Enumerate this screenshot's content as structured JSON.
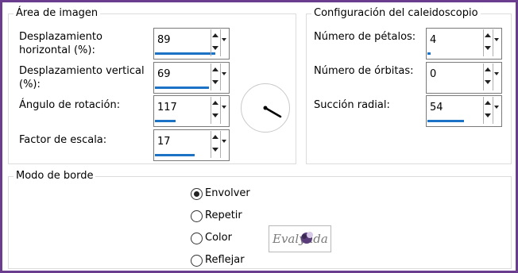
{
  "image_area": {
    "title": "Área de imagen",
    "fields": [
      {
        "label_line1": "Desplazamiento",
        "label_line2": "horizontal (%):",
        "value": "89",
        "fill": 0.95
      },
      {
        "label_line1": "Desplazamiento vertical",
        "label_line2": "(%):",
        "value": "69",
        "fill": 0.85
      },
      {
        "label_line1": "Ángulo de rotación:",
        "label_line2": "",
        "value": "117",
        "fill": 0.33
      },
      {
        "label_line1": "Factor de escala:",
        "label_line2": "",
        "value": "17",
        "fill": 0.62
      }
    ]
  },
  "kaleidoscope": {
    "title": "Configuración del caleidoscopio",
    "fields": [
      {
        "label": "Número de pétalos:",
        "value": "4",
        "fill": 0.05
      },
      {
        "label": "Número de órbitas:",
        "value": "0",
        "fill": 0.0
      },
      {
        "label": "Succión radial:",
        "value": "54",
        "fill": 0.58
      }
    ]
  },
  "border_mode": {
    "title": "Modo de borde",
    "options": [
      {
        "label": "Envolver",
        "checked": true
      },
      {
        "label": "Repetir",
        "checked": false
      },
      {
        "label": "Color",
        "checked": false
      },
      {
        "label": "Reflejar",
        "checked": false
      }
    ],
    "color_swatch_text": "Evalynda"
  },
  "colors": {
    "accent": "#1c72c4",
    "frame": "#6a3d8f"
  }
}
